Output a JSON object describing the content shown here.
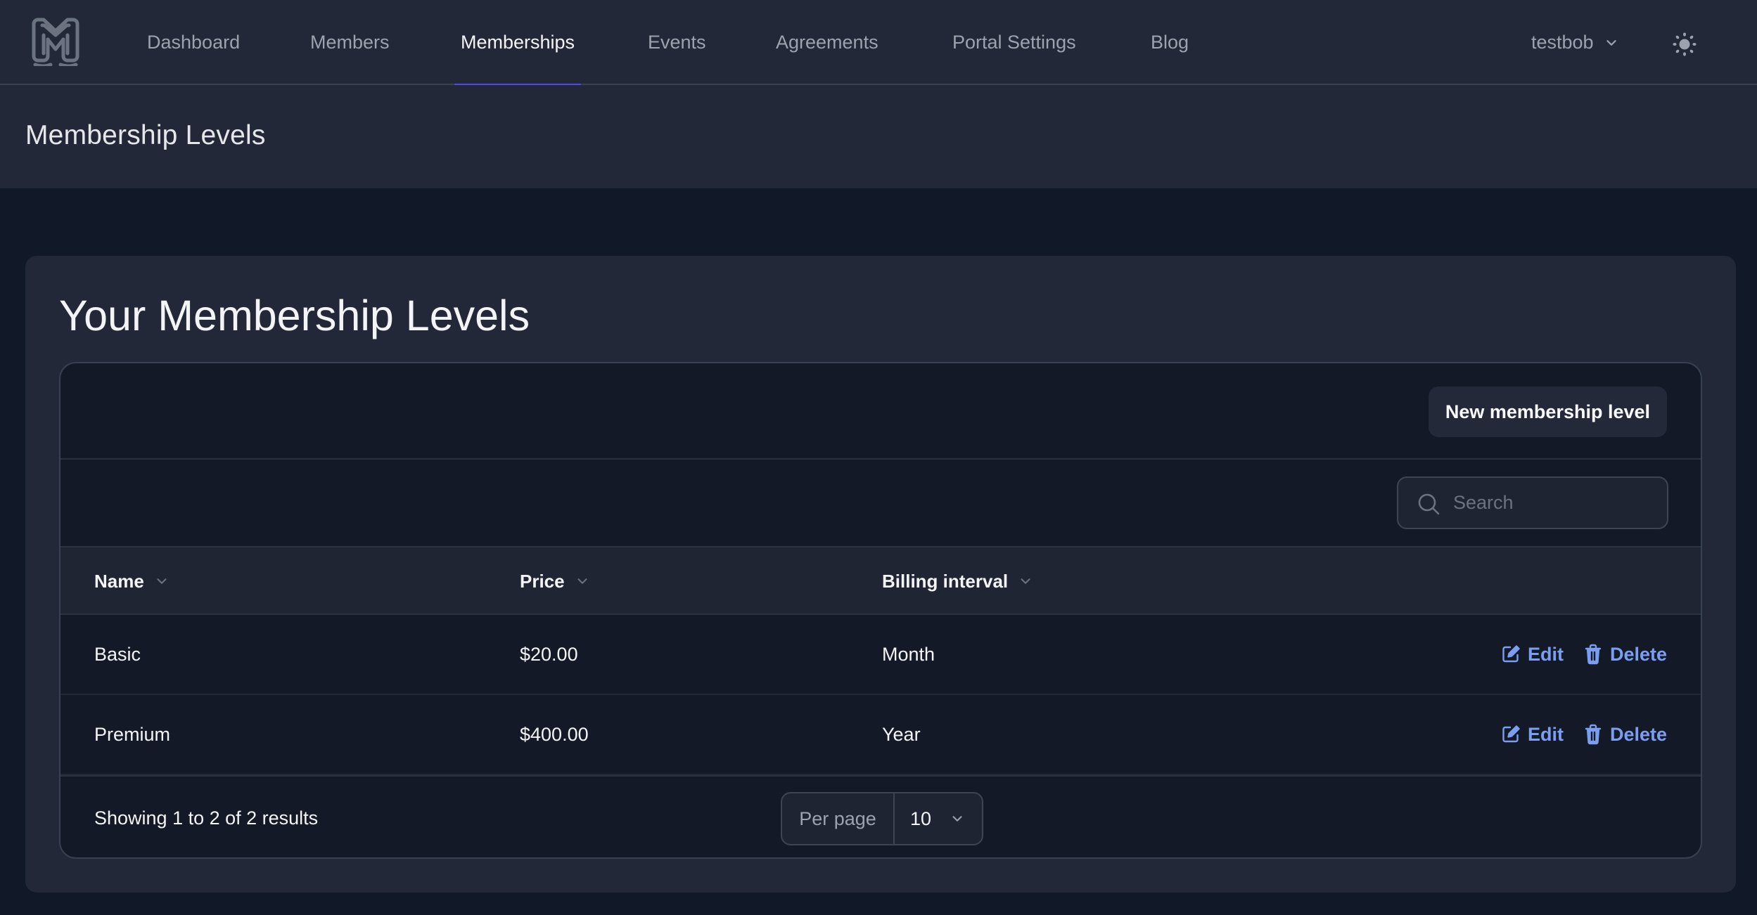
{
  "topbar": {
    "logo_alt": "M logo",
    "nav": [
      {
        "label": "Dashboard",
        "active": false
      },
      {
        "label": "Members",
        "active": false
      },
      {
        "label": "Memberships",
        "active": true
      },
      {
        "label": "Events",
        "active": false
      },
      {
        "label": "Agreements",
        "active": false
      },
      {
        "label": "Portal Settings",
        "active": false
      },
      {
        "label": "Blog",
        "active": false
      }
    ],
    "user": {
      "name": "testbob",
      "icon": "chevron-down-icon"
    },
    "theme_toggle": {
      "icon": "sun-icon"
    },
    "accent_color": "#4f46e5"
  },
  "page_header": {
    "title": "Membership Levels"
  },
  "card": {
    "title": "Your Membership Levels",
    "new_button_label": "New membership level",
    "search": {
      "placeholder": "Search",
      "value": ""
    },
    "columns": [
      {
        "label": "Name",
        "sortable": true
      },
      {
        "label": "Price",
        "sortable": true
      },
      {
        "label": "Billing interval",
        "sortable": true
      }
    ],
    "rows": [
      {
        "name": "Basic",
        "price": "$20.00",
        "interval": "Month",
        "edit_label": "Edit",
        "delete_label": "Delete"
      },
      {
        "name": "Premium",
        "price": "$400.00",
        "interval": "Year",
        "edit_label": "Edit",
        "delete_label": "Delete"
      }
    ],
    "action_color": "#7c9ef0",
    "footer": {
      "results_text": "Showing 1 to 2 of 2 results",
      "per_page_label": "Per page",
      "per_page_value": "10"
    }
  }
}
